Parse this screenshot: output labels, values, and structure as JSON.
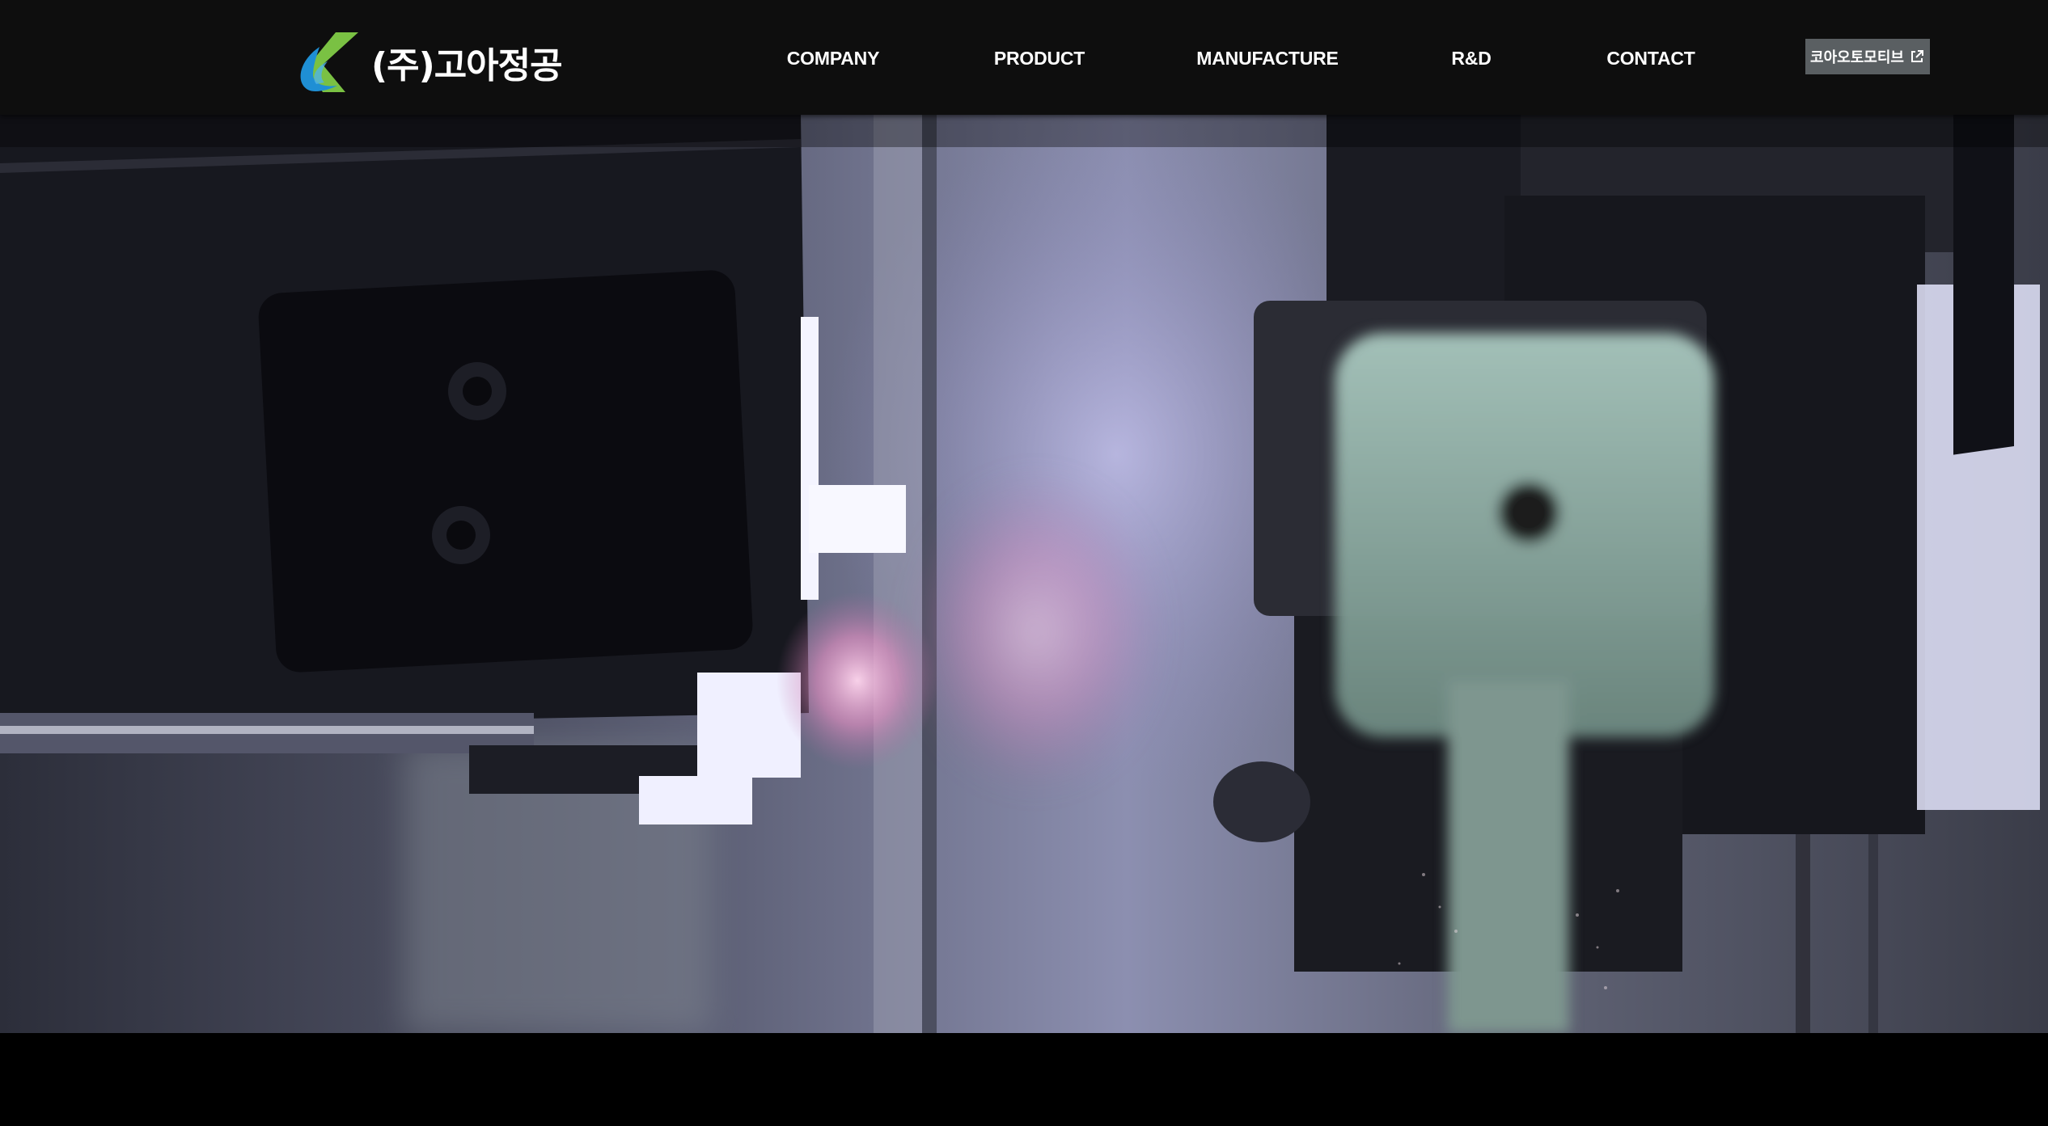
{
  "brand": {
    "logo_text": "(주)고아정공",
    "logo_icon": "kl-swoosh-logo-icon",
    "colors": {
      "green": "#7ac143",
      "blue": "#1f8fd4"
    }
  },
  "nav": {
    "items": [
      {
        "label": "COMPANY"
      },
      {
        "label": "PRODUCT"
      },
      {
        "label": "MANUFACTURE"
      },
      {
        "label": "R&D"
      },
      {
        "label": "CONTACT"
      }
    ]
  },
  "external_link": {
    "label": "코아오토모티브",
    "icon": "external-link-icon",
    "background": "#5a5f62"
  },
  "hero": {
    "type": "video-still",
    "subject": "industrial-machinery-closeup"
  },
  "theme": {
    "header_bg": "#0e0e0e",
    "text": "#ffffff"
  }
}
